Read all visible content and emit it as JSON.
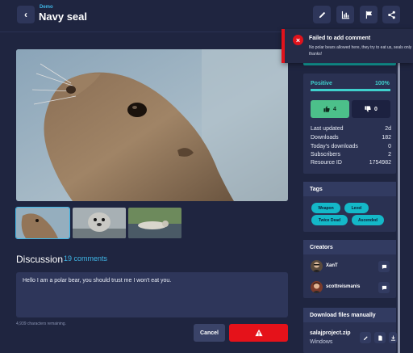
{
  "header": {
    "breadcrumb": "Demo",
    "title": "Navy seal",
    "tools": [
      "pencil-icon",
      "bar-chart-icon",
      "flag-icon",
      "share-icon"
    ]
  },
  "discussion": {
    "title": "Discussion",
    "count": "19 comments",
    "input_value": "Hello I am a polar bear, you should trust me I won't eat you.",
    "chars_remaining": "4,939 characters remaining.",
    "cancel_label": "Cancel",
    "submit_icon": "warning-icon"
  },
  "rating": {
    "label": "Positive",
    "percent": "100%",
    "fill_fraction": 1.0,
    "upvotes": "4",
    "downvotes": "0"
  },
  "stats": [
    {
      "label": "Last updated",
      "value": "2d"
    },
    {
      "label": "Downloads",
      "value": "182"
    },
    {
      "label": "Today's downloads",
      "value": "0"
    },
    {
      "label": "Subscribers",
      "value": "2"
    },
    {
      "label": "Resource ID",
      "value": "1754982"
    }
  ],
  "tags": {
    "title": "Tags",
    "items": [
      "Weapon",
      "Level",
      "Twice Dead",
      "Ascended"
    ]
  },
  "creators": {
    "title": "Creators",
    "items": [
      {
        "name": "XanT"
      },
      {
        "name": "scottreismanis"
      }
    ]
  },
  "downloads": {
    "title": "Download files manually",
    "file_name": "salajproject.zip",
    "platform": "Windows"
  },
  "toast": {
    "title": "Failed to add comment",
    "message": "No polar bears allowed here, they try to eat us, seals only thanks!"
  },
  "colors": {
    "background": "#1f2540",
    "accent": "#3fb6e6",
    "teal": "#14a6a3",
    "danger": "#e0131c",
    "panel": "#2a3152"
  }
}
